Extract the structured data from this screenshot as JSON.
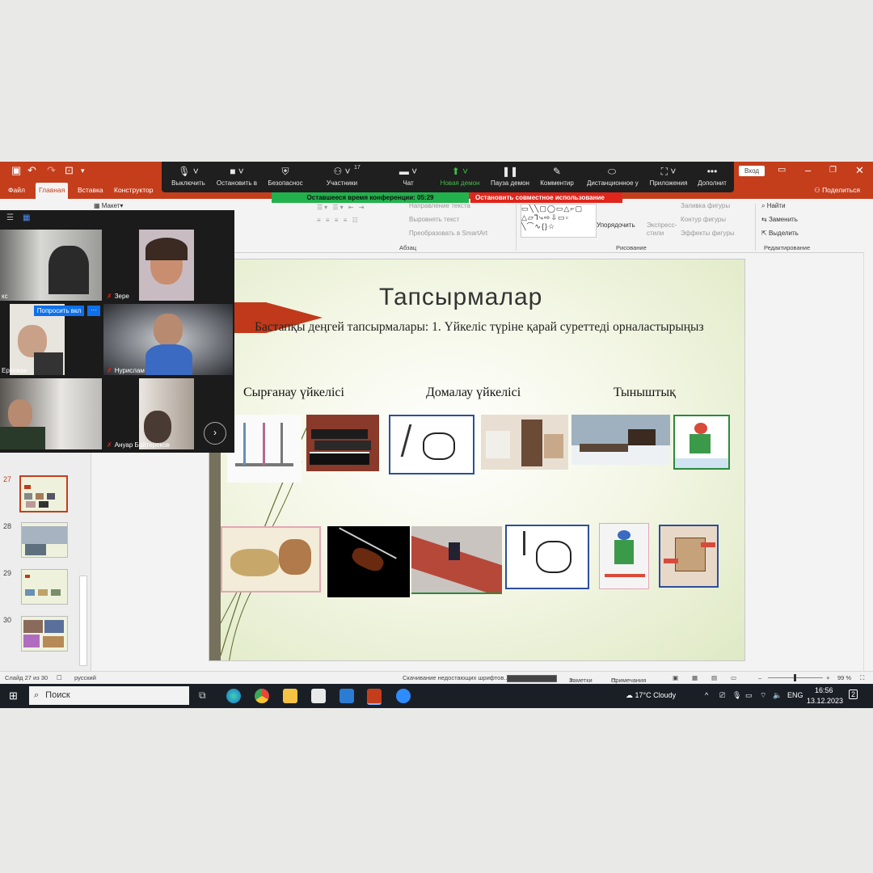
{
  "powerpoint": {
    "tabs": [
      "Файл",
      "Главная",
      "Вставка",
      "Конструктор"
    ],
    "share_label": "Поделиться",
    "signin_label": "Вход",
    "ribbon": {
      "layout_label": "Макет",
      "text_direction": "Направление текста",
      "align_text": "Выровнять текст",
      "smartart": "Преобразовать в SmartArt",
      "paragraph_group": "Абзац",
      "arrange": "Упорядочить",
      "quick_styles": "Экспресс-стили",
      "shape_fill": "Заливка фигуры",
      "shape_outline": "Контур фигуры",
      "shape_effects": "Эффекты фигуры",
      "drawing_group": "Рисование",
      "find": "Найти",
      "replace": "Заменить",
      "select": "Выделить",
      "editing_group": "Редактирование"
    }
  },
  "zoom_toolbar": {
    "items": [
      "Выключить",
      "Остановить в",
      "Безопаснос",
      "Участники",
      "Чат",
      "Новая демон",
      "Пауза демон",
      "Комментир",
      "Дистанционное у",
      "Приложения",
      "Дополнит"
    ],
    "participants_count": "17",
    "timer": "Оставшееся время конференции: 05:29",
    "stop_share": "Остановить совместное использование"
  },
  "gallery": {
    "participants": [
      {
        "name": "кс"
      },
      {
        "name": "Зере"
      },
      {
        "name": "Еркежан"
      },
      {
        "name": "Нурислам"
      },
      {
        "name": ""
      },
      {
        "name": "Ануар Байтереков"
      }
    ],
    "ask_button": "Попросить вкл",
    "more_button": "···"
  },
  "thumbnails": [
    {
      "num": "27"
    },
    {
      "num": "28"
    },
    {
      "num": "29"
    },
    {
      "num": "30"
    }
  ],
  "slide": {
    "title": "Тапсырмалар",
    "subtitle": "Бастапқы деңгей  тапсырмалары: 1. Үйкеліс түріне қарай суреттеді орналастырыңыз",
    "columns": [
      "Сырғанау үйкелісі",
      "Домалау үйкелісі",
      "Тыныштық"
    ]
  },
  "statusbar": {
    "slide_info": "Слайд 27 из 30",
    "language": "русский",
    "font_download": "Скачивание недостающих шрифтов...",
    "notes": "Заметки",
    "comments": "Примечания",
    "zoom": "99 %"
  },
  "taskbar": {
    "search": "Поиск",
    "weather": "17°C  Cloudy",
    "lang": "ENG",
    "time": "16:56",
    "date": "13.12.2023",
    "notifications": "2"
  }
}
